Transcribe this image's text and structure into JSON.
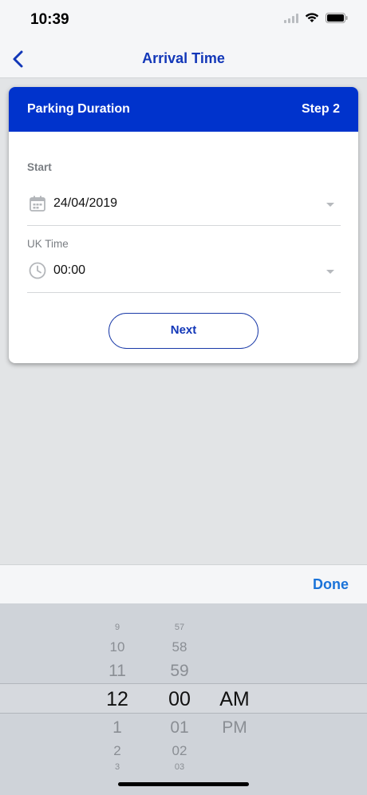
{
  "status_bar": {
    "time": "10:39"
  },
  "nav": {
    "title": "Arrival Time"
  },
  "card": {
    "title": "Parking Duration",
    "step": "Step 2",
    "start_label": "Start",
    "date_value": "24/04/2019",
    "time_label": "UK Time",
    "time_value": "00:00",
    "next_label": "Next"
  },
  "toolbar": {
    "done_label": "Done"
  },
  "picker": {
    "hours": [
      "9",
      "10",
      "11",
      "12",
      "1",
      "2",
      "3"
    ],
    "minutes": [
      "57",
      "58",
      "59",
      "00",
      "01",
      "02",
      "03"
    ],
    "ampm": [
      "AM",
      "PM"
    ],
    "selected_hour": "12",
    "selected_minute": "00",
    "selected_period": "AM"
  },
  "colors": {
    "header_blue": "#0033cc",
    "title_blue": "#1237b8",
    "done_blue": "#1a73d9"
  },
  "icons": [
    "back-chevron-icon",
    "signal-icon",
    "wifi-icon",
    "battery-icon",
    "calendar-icon",
    "clock-icon",
    "dropdown-arrow-icon"
  ]
}
